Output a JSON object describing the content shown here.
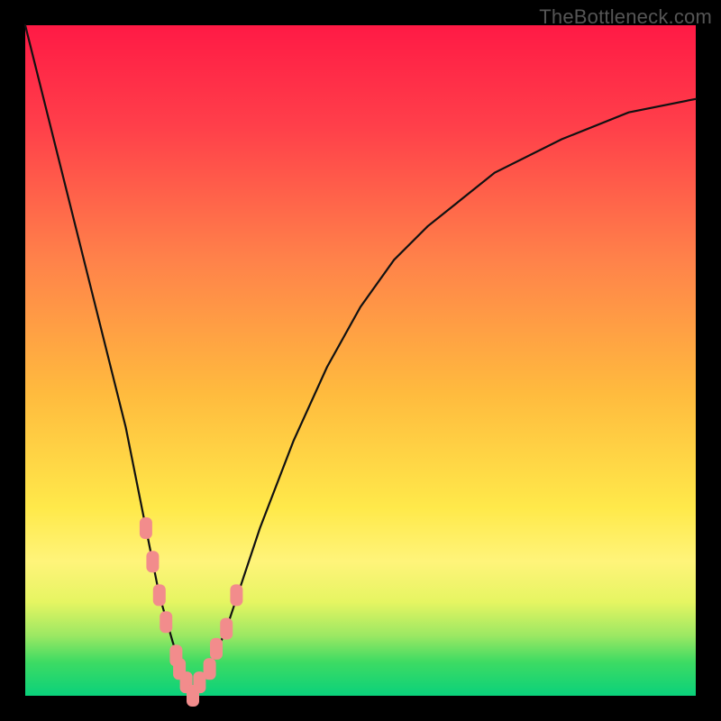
{
  "watermark": "TheBottleneck.com",
  "colors": {
    "frame": "#000000",
    "curve": "#111111",
    "marker_fill": "#f28c8c",
    "marker_stroke": "#c96f6f"
  },
  "chart_data": {
    "type": "line",
    "title": "",
    "xlabel": "",
    "ylabel": "",
    "xlim": [
      0,
      100
    ],
    "ylim": [
      0,
      100
    ],
    "grid": false,
    "legend": false,
    "series": [
      {
        "name": "bottleneck-curve",
        "x": [
          0,
          5,
          10,
          15,
          18,
          20,
          22,
          24,
          25,
          27,
          30,
          35,
          40,
          45,
          50,
          55,
          60,
          70,
          80,
          90,
          100
        ],
        "values": [
          100,
          80,
          60,
          40,
          25,
          15,
          8,
          2,
          0,
          3,
          10,
          25,
          38,
          49,
          58,
          65,
          70,
          78,
          83,
          87,
          89
        ]
      }
    ],
    "markers": {
      "name": "highlighted-points",
      "shape": "rounded-rect",
      "x": [
        18.0,
        19.0,
        20.0,
        21.0,
        22.5,
        23.0,
        24.0,
        25.0,
        26.0,
        27.5,
        28.5,
        30.0,
        31.5
      ],
      "values": [
        25.0,
        20.0,
        15.0,
        11.0,
        6.0,
        4.0,
        2.0,
        0.0,
        2.0,
        4.0,
        7.0,
        10.0,
        15.0
      ]
    }
  }
}
